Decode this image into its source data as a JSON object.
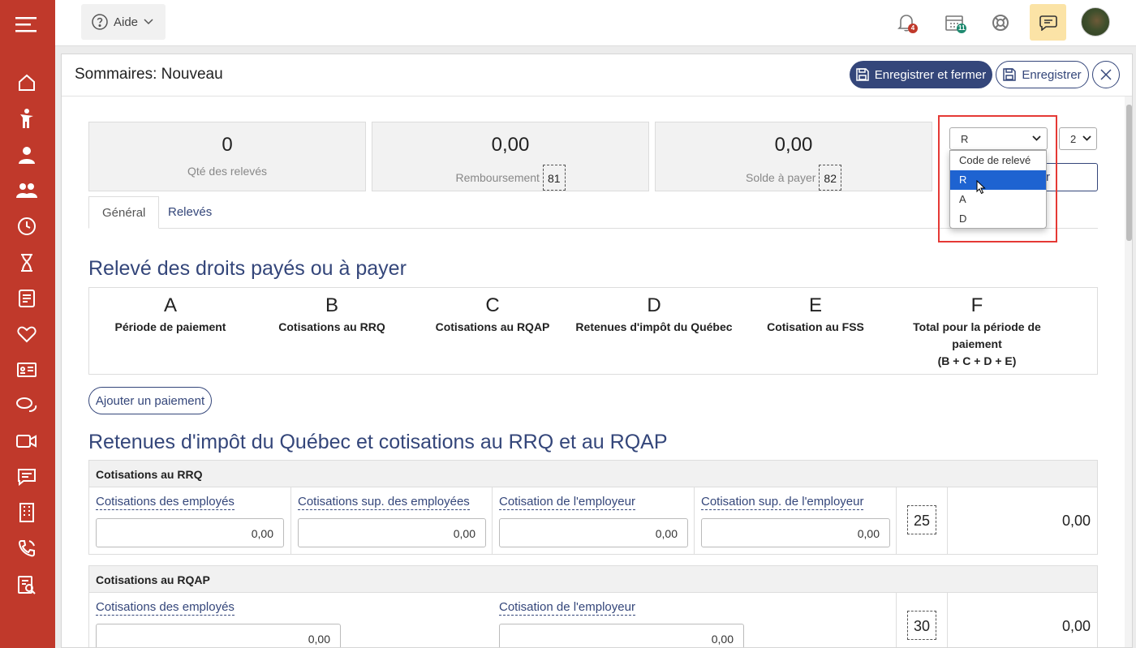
{
  "sidebar": {
    "icons": [
      "menu-icon",
      "home-icon",
      "person-icon",
      "user-icon",
      "users-icon",
      "clock-icon",
      "hourglass-icon",
      "checklist-icon",
      "heart-icon",
      "id-card-icon",
      "chat-icon",
      "video-icon",
      "message-icon",
      "building-icon",
      "phone-icon",
      "report-icon"
    ]
  },
  "topbar": {
    "help_label": "Aide",
    "notifications_count": "4",
    "calendar_count": "11"
  },
  "modal": {
    "title": "Sommaires: Nouveau",
    "save_close_label": "Enregistrer et fermer",
    "save_label": "Enregistrer"
  },
  "stats": [
    {
      "value": "0",
      "label": "Qté des relevés",
      "code": ""
    },
    {
      "value": "0,00",
      "label": "Remboursement",
      "code": "81"
    },
    {
      "value": "0,00",
      "label": "Solde à payer",
      "code": "82"
    }
  ],
  "code_select": {
    "value": "R",
    "options": [
      "Code de relevé",
      "R",
      "A",
      "D"
    ],
    "selected_index": 1
  },
  "number_select": {
    "value": "2"
  },
  "tabs": [
    "Général",
    "Relevés"
  ],
  "section1": {
    "title": "Relevé des droits payés ou à payer",
    "columns": [
      {
        "letter": "A",
        "desc": "Période de paiement"
      },
      {
        "letter": "B",
        "desc": "Cotisations au RRQ"
      },
      {
        "letter": "C",
        "desc": "Cotisations au RQAP"
      },
      {
        "letter": "D",
        "desc": "Retenues d'impôt du Québec"
      },
      {
        "letter": "E",
        "desc": "Cotisation au FSS"
      },
      {
        "letter": "F",
        "desc": "Total pour la période de paiement",
        "formula": "(B + C + D + E)"
      }
    ],
    "add_payment_label": "Ajouter un paiement"
  },
  "section2": {
    "title": "Retenues d'impôt du Québec et cotisations au RRQ et au RQAP",
    "rrq": {
      "header": "Cotisations au RRQ",
      "fields": [
        {
          "label": "Cotisations des employés",
          "value": "0,00"
        },
        {
          "label": "Cotisations sup. des employées",
          "value": "0,00"
        },
        {
          "label": "Cotisation de l'employeur",
          "value": "0,00"
        },
        {
          "label": "Cotisation sup. de l'employeur",
          "value": "0,00"
        }
      ],
      "code": "25",
      "total": "0,00"
    },
    "rqap": {
      "header": "Cotisations au RQAP",
      "fields": [
        {
          "label": "Cotisations des employés",
          "value": "0,00"
        },
        {
          "label": "Cotisation de l'employeur",
          "value": "0,00"
        }
      ],
      "code": "30",
      "total": "0,00"
    }
  },
  "colors": {
    "sidebar": "#c0392b",
    "primary": "#34467a",
    "highlight": "#e53935",
    "option_selected": "#1e63d1"
  }
}
